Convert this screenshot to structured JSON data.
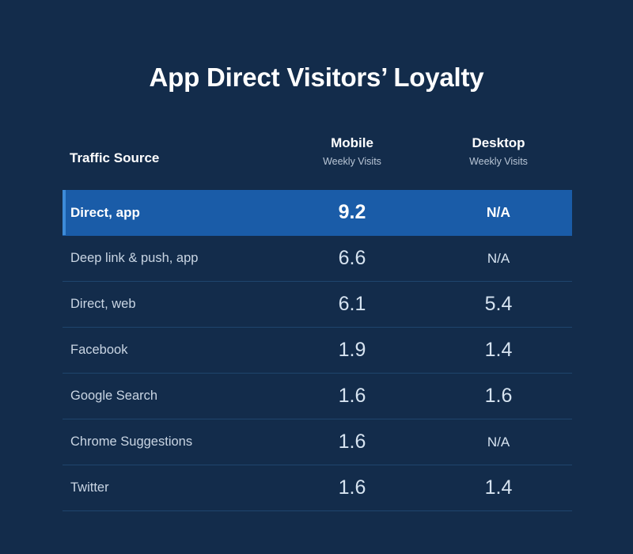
{
  "page": {
    "title": "App Direct Visitors’ Loyalty",
    "background_color": "#132c4b",
    "highlight_color": "#1a5ca8",
    "accent_bar_color": "#3d8bd8",
    "divider_color": "#1f456d"
  },
  "table": {
    "headers": {
      "source": "Traffic Source",
      "mobile": {
        "main": "Mobile",
        "sub": "Weekly Visits"
      },
      "desktop": {
        "main": "Desktop",
        "sub": "Weekly Visits"
      }
    },
    "rows": [
      {
        "source": "Direct, app",
        "mobile": "9.2",
        "desktop": "N/A",
        "highlighted": true
      },
      {
        "source": "Deep link & push, app",
        "mobile": "6.6",
        "desktop": "N/A",
        "highlighted": false
      },
      {
        "source": "Direct, web",
        "mobile": "6.1",
        "desktop": "5.4",
        "highlighted": false
      },
      {
        "source": "Facebook",
        "mobile": "1.9",
        "desktop": "1.4",
        "highlighted": false
      },
      {
        "source": "Google Search",
        "mobile": "1.6",
        "desktop": "1.6",
        "highlighted": false
      },
      {
        "source": "Chrome Suggestions",
        "mobile": "1.6",
        "desktop": "N/A",
        "highlighted": false
      },
      {
        "source": "Twitter",
        "mobile": "1.6",
        "desktop": "1.4",
        "highlighted": false
      }
    ]
  },
  "chart_data": {
    "type": "table",
    "title": "App Direct Visitors’ Loyalty",
    "columns": [
      "Traffic Source",
      "Mobile Weekly Visits",
      "Desktop Weekly Visits"
    ],
    "categories": [
      "Direct, app",
      "Deep link & push, app",
      "Direct, web",
      "Facebook",
      "Google Search",
      "Chrome Suggestions",
      "Twitter"
    ],
    "series": [
      {
        "name": "Mobile Weekly Visits",
        "values": [
          9.2,
          6.6,
          6.1,
          1.9,
          1.6,
          1.6,
          1.6
        ]
      },
      {
        "name": "Desktop Weekly Visits",
        "values": [
          null,
          null,
          5.4,
          1.4,
          1.6,
          null,
          1.4
        ]
      }
    ],
    "missing_value_label": "N/A",
    "highlighted_row": "Direct, app",
    "xlabel": "",
    "ylabel": "Weekly Visits"
  }
}
